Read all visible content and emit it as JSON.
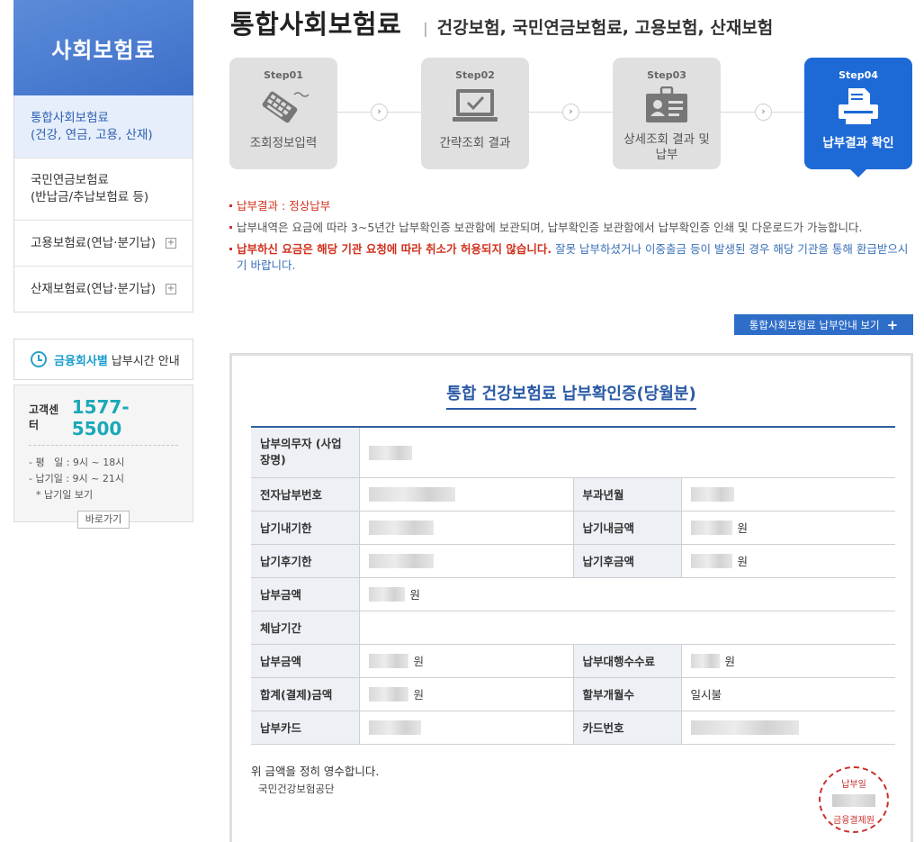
{
  "sidebar": {
    "title": "사회보험료",
    "items": [
      {
        "line1": "통합사회보험료",
        "line2": "(건강, 연금, 고용, 산재)",
        "active": true,
        "expand": ""
      },
      {
        "line1": "국민연금보험료",
        "line2": "(반납금/추납보험료 등)",
        "active": false,
        "expand": ""
      },
      {
        "line1": "고용보험료(연납·분기납)",
        "line2": "",
        "active": false,
        "expand": "+"
      },
      {
        "line1": "산재보험료(연납·분기납)",
        "line2": "",
        "active": false,
        "expand": "+"
      }
    ],
    "time_guide": {
      "highlight": "금융회사별",
      "text": "납부시간 안내"
    },
    "customer_center": {
      "label": "고객센터",
      "phone": "1577-5500",
      "lines": [
        "- 평   일 : 9시 ~ 18시",
        "- 납기일 : 9시 ~ 21시",
        "* 납기일 보기"
      ],
      "button": "바로가기"
    }
  },
  "header": {
    "title": "통합사회보험료",
    "subtitle": "건강보험, 국민연금보험료, 고용보험, 산재보험"
  },
  "steps": [
    {
      "num": "Step01",
      "label": "조회정보입력",
      "icon": "keyboard-icon",
      "active": false
    },
    {
      "num": "Step02",
      "label": "간략조회 결과",
      "icon": "monitor-check-icon",
      "active": false
    },
    {
      "num": "Step03",
      "label": "상세조회 결과 및 납부",
      "icon": "id-card-icon",
      "active": false
    },
    {
      "num": "Step04",
      "label": "납부결과 확인",
      "icon": "printer-icon",
      "active": true
    }
  ],
  "notes": {
    "result_label": "납부결과",
    "result_value": "정상납부",
    "line2": "납부내역은 요금에 따라 3~5년간 납부확인증 보관함에 보관되며, 납부확인증 보관함에서 납부확인증 인쇄 및 다운로드가 가능합니다.",
    "line3_red": "납부하신 요금은 해당 기관 요청에 따라 취소가 허용되지 않습니다.",
    "line3_blue": "잘못 납부하셨거나 이중출금 등이 발생된 경우 해당 기관을 통해 환급받으시기 바랍니다."
  },
  "guide_button": "통합사회보험료 납부안내 보기",
  "certificate": {
    "title": "통합 건강보험료 납부확인증(당월분)",
    "labels": {
      "payer": "납부의무자 (사업장명)",
      "e_number": "전자납부번호",
      "billing_month": "부과년월",
      "due_date": "납기내기한",
      "due_amount": "납기내금액",
      "late_date": "납기후기한",
      "late_amount": "납기후금액",
      "paid_amount": "납부금액",
      "arrears_period": "체납기간",
      "paid_amount2": "납부금액",
      "agency_fee": "납부대행수수료",
      "total_amount": "합계(결제)금액",
      "installments": "할부개월수",
      "card": "납부카드",
      "card_number": "카드번호"
    },
    "won": "원",
    "installments_value": "일시불",
    "receipt_text": "위 금액을 정히 영수합니다.",
    "issuer": "국민건강보험공단",
    "stamp_top": "납부일",
    "stamp_bottom": "금융결제원"
  }
}
